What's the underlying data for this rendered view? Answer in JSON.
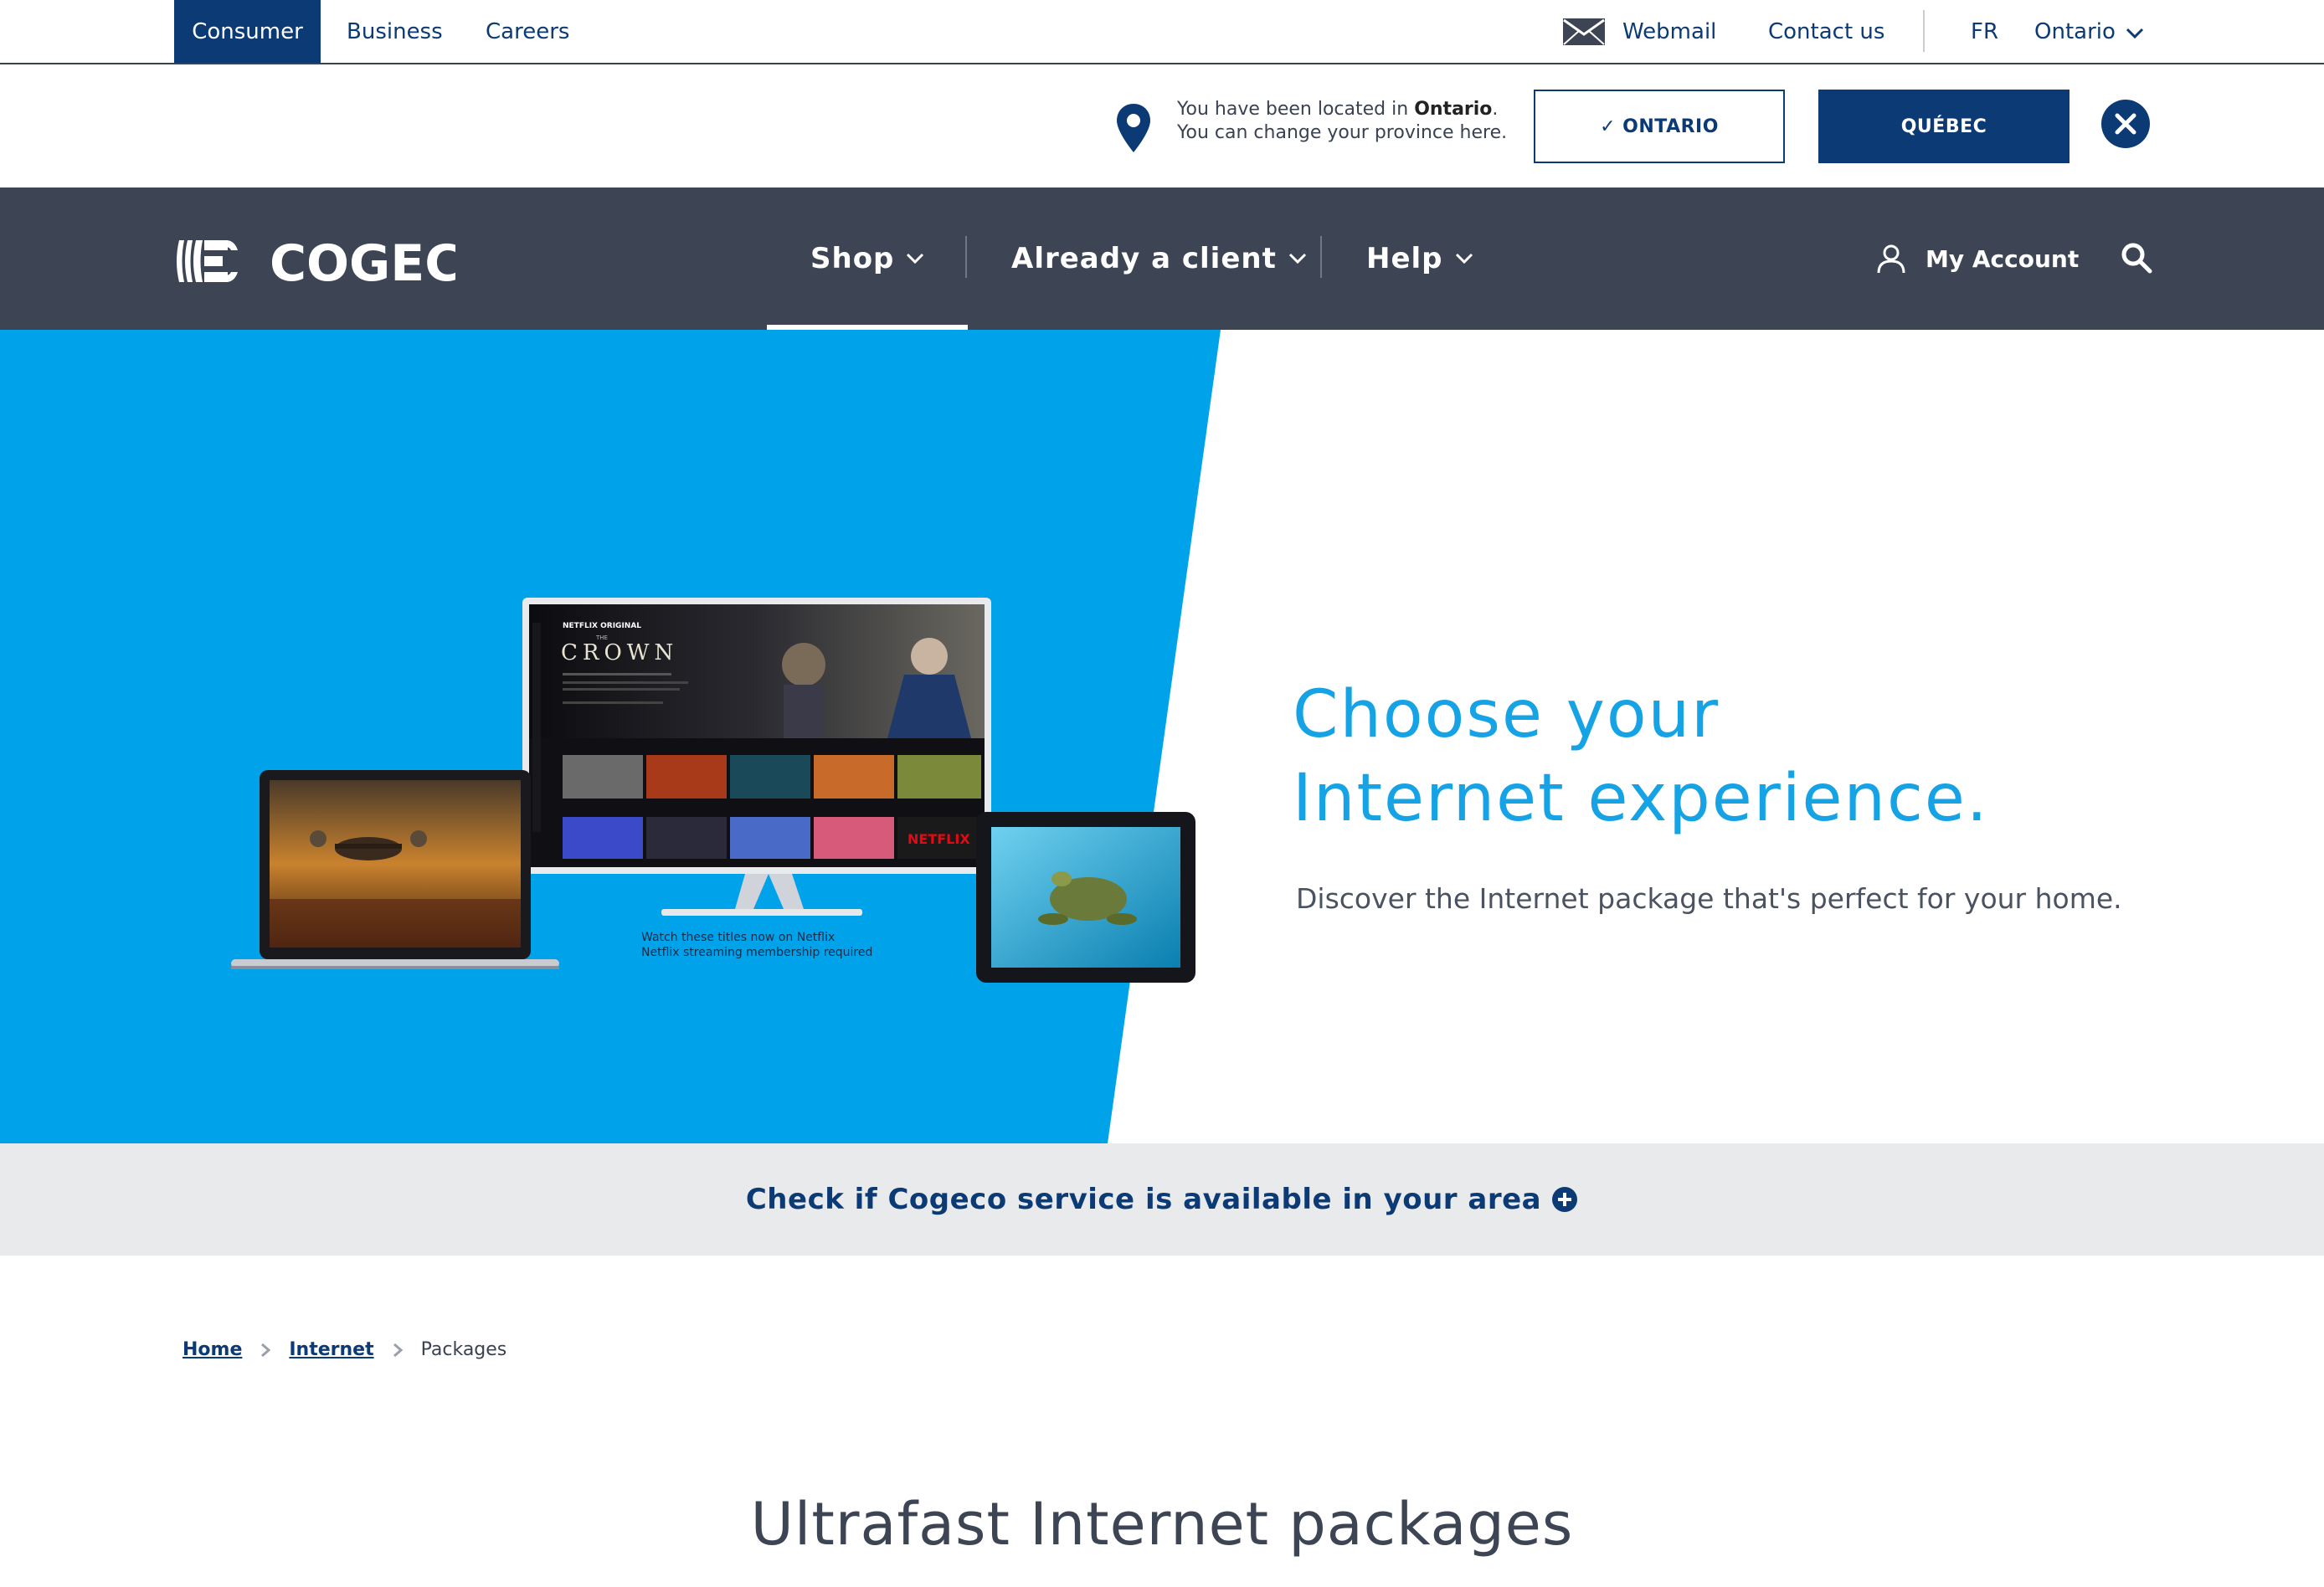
{
  "topbar": {
    "segments": [
      {
        "label": "Consumer",
        "active": true
      },
      {
        "label": "Business",
        "active": false
      },
      {
        "label": "Careers",
        "active": false
      }
    ],
    "webmail": "Webmail",
    "contact": "Contact us",
    "language": "FR",
    "province": "Ontario"
  },
  "notice": {
    "line1_prefix": "You have been located in ",
    "line1_province": "Ontario",
    "line1_suffix": ".",
    "line2": "You can change your province here.",
    "ontario_button": "✓ ONTARIO",
    "quebec_button": "QUÉBEC"
  },
  "nav": {
    "brand": "COGECO",
    "items": [
      "Shop",
      "Already a client",
      "Help"
    ],
    "account": "My Account"
  },
  "hero": {
    "title_line1": "Choose your",
    "title_line2": "Internet experience.",
    "subtitle": "Discover the Internet package that's perfect for your home.",
    "tv_caption_line1": "Watch these titles now on Netflix",
    "tv_caption_line2": "Netflix streaming membership required",
    "tv_brand": "NETFLIX ORIGINAL",
    "tv_show": "CROWN",
    "tv_show_pre": "THE"
  },
  "availability": {
    "label": "Check if Cogeco service is available in your area"
  },
  "breadcrumb": {
    "home": "Home",
    "internet": "Internet",
    "current": "Packages"
  },
  "section": {
    "title": "Ultrafast Internet packages"
  },
  "colors": {
    "brand_navy": "#0b3a75",
    "nav_bg": "#3d4554",
    "hero_blue": "#00a3ea",
    "hero_title": "#15a3e6",
    "avail_bg": "#e9eaec"
  },
  "icons": [
    "envelope-icon",
    "chevron-down-icon",
    "location-pin-icon",
    "close-icon",
    "user-icon",
    "search-icon",
    "plus-circle-icon",
    "chevron-right-icon"
  ]
}
